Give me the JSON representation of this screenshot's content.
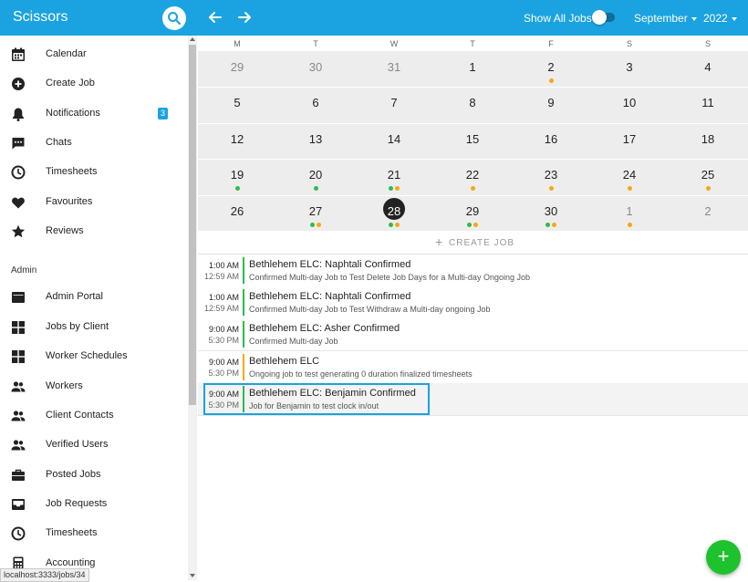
{
  "app": {
    "title": "Scissors"
  },
  "header": {
    "show_all_label": "Show All Jobs",
    "month": "September",
    "year": "2022"
  },
  "colors": {
    "accent": "#1aa3e0",
    "dot_green": "#2dbb4e",
    "dot_orange": "#f4a812",
    "fab": "#1ec22c"
  },
  "sidebar": {
    "items": [
      {
        "label": "Calendar",
        "icon": "calendar-icon"
      },
      {
        "label": "Create Job",
        "icon": "add-circle-icon"
      },
      {
        "label": "Notifications",
        "icon": "bell-icon",
        "badge": "3"
      },
      {
        "label": "Chats",
        "icon": "chat-icon"
      },
      {
        "label": "Timesheets",
        "icon": "clock-icon"
      },
      {
        "label": "Favourites",
        "icon": "heart-icon"
      },
      {
        "label": "Reviews",
        "icon": "star-icon"
      }
    ],
    "admin_heading": "Admin",
    "admin_items": [
      {
        "label": "Admin Portal",
        "icon": "portal-icon"
      },
      {
        "label": "Jobs by Client",
        "icon": "grid-icon"
      },
      {
        "label": "Worker Schedules",
        "icon": "grid-icon"
      },
      {
        "label": "Workers",
        "icon": "people-icon"
      },
      {
        "label": "Client Contacts",
        "icon": "people-icon"
      },
      {
        "label": "Verified Users",
        "icon": "people-icon"
      },
      {
        "label": "Posted Jobs",
        "icon": "briefcase-icon"
      },
      {
        "label": "Job Requests",
        "icon": "inbox-icon"
      },
      {
        "label": "Timesheets",
        "icon": "clock-icon"
      },
      {
        "label": "Accounting",
        "icon": "calculator-icon"
      }
    ]
  },
  "calendar": {
    "weekdays": [
      "M",
      "T",
      "W",
      "T",
      "F",
      "S",
      "S"
    ],
    "weeks": [
      [
        {
          "d": "29",
          "m": true
        },
        {
          "d": "30",
          "m": true
        },
        {
          "d": "31",
          "m": true
        },
        {
          "d": "1"
        },
        {
          "d": "2",
          "dots": [
            "o"
          ]
        },
        {
          "d": "3"
        },
        {
          "d": "4"
        }
      ],
      [
        {
          "d": "5"
        },
        {
          "d": "6"
        },
        {
          "d": "7"
        },
        {
          "d": "8"
        },
        {
          "d": "9"
        },
        {
          "d": "10"
        },
        {
          "d": "11"
        }
      ],
      [
        {
          "d": "12"
        },
        {
          "d": "13"
        },
        {
          "d": "14"
        },
        {
          "d": "15"
        },
        {
          "d": "16"
        },
        {
          "d": "17"
        },
        {
          "d": "18"
        }
      ],
      [
        {
          "d": "19",
          "dots": [
            "g"
          ]
        },
        {
          "d": "20",
          "dots": [
            "g"
          ]
        },
        {
          "d": "21",
          "dots": [
            "g",
            "o"
          ]
        },
        {
          "d": "22",
          "dots": [
            "o"
          ]
        },
        {
          "d": "23",
          "dots": [
            "o"
          ]
        },
        {
          "d": "24",
          "dots": [
            "o"
          ]
        },
        {
          "d": "25",
          "dots": [
            "o"
          ]
        }
      ],
      [
        {
          "d": "26"
        },
        {
          "d": "27",
          "dots": [
            "g",
            "o"
          ]
        },
        {
          "d": "28",
          "today": true,
          "dots": [
            "g",
            "o"
          ]
        },
        {
          "d": "29",
          "dots": [
            "g",
            "o"
          ]
        },
        {
          "d": "30",
          "dots": [
            "g",
            "o"
          ]
        },
        {
          "d": "1",
          "m": true,
          "dots": [
            "o"
          ]
        },
        {
          "d": "2",
          "m": true
        }
      ]
    ],
    "create_label": "CREATE JOB"
  },
  "jobs": [
    {
      "start": "1:00 AM",
      "end": "12:59 AM",
      "title": "Bethlehem ELC: Naphtali Confirmed",
      "desc": "Confirmed Multi-day Job to Test Delete Job Days for a Multi-day Ongoing Job",
      "status": "g"
    },
    {
      "start": "1:00 AM",
      "end": "12:59 AM",
      "title": "Bethlehem ELC: Naphtali Confirmed",
      "desc": "Confirmed Multi-day Job to Test Withdraw a Multi-day ongoing Job",
      "status": "g"
    },
    {
      "start": "9:00 AM",
      "end": "5:30 PM",
      "title": "Bethlehem ELC: Asher Confirmed",
      "desc": "Confirmed Multi-day Job",
      "status": "g"
    },
    {
      "start": "9:00 AM",
      "end": "5:30 PM",
      "title": "Bethlehem ELC",
      "desc": "Ongoing job to test generating 0 duration finalized timesheets",
      "status": "o"
    },
    {
      "start": "9:00 AM",
      "end": "5:30 PM",
      "title": "Bethlehem ELC: Benjamin Confirmed",
      "desc": "Job for Benjamin to test clock in/out",
      "status": "g",
      "selected": true
    }
  ],
  "status_url": "localhost:3333/jobs/34",
  "fab_label": "+"
}
